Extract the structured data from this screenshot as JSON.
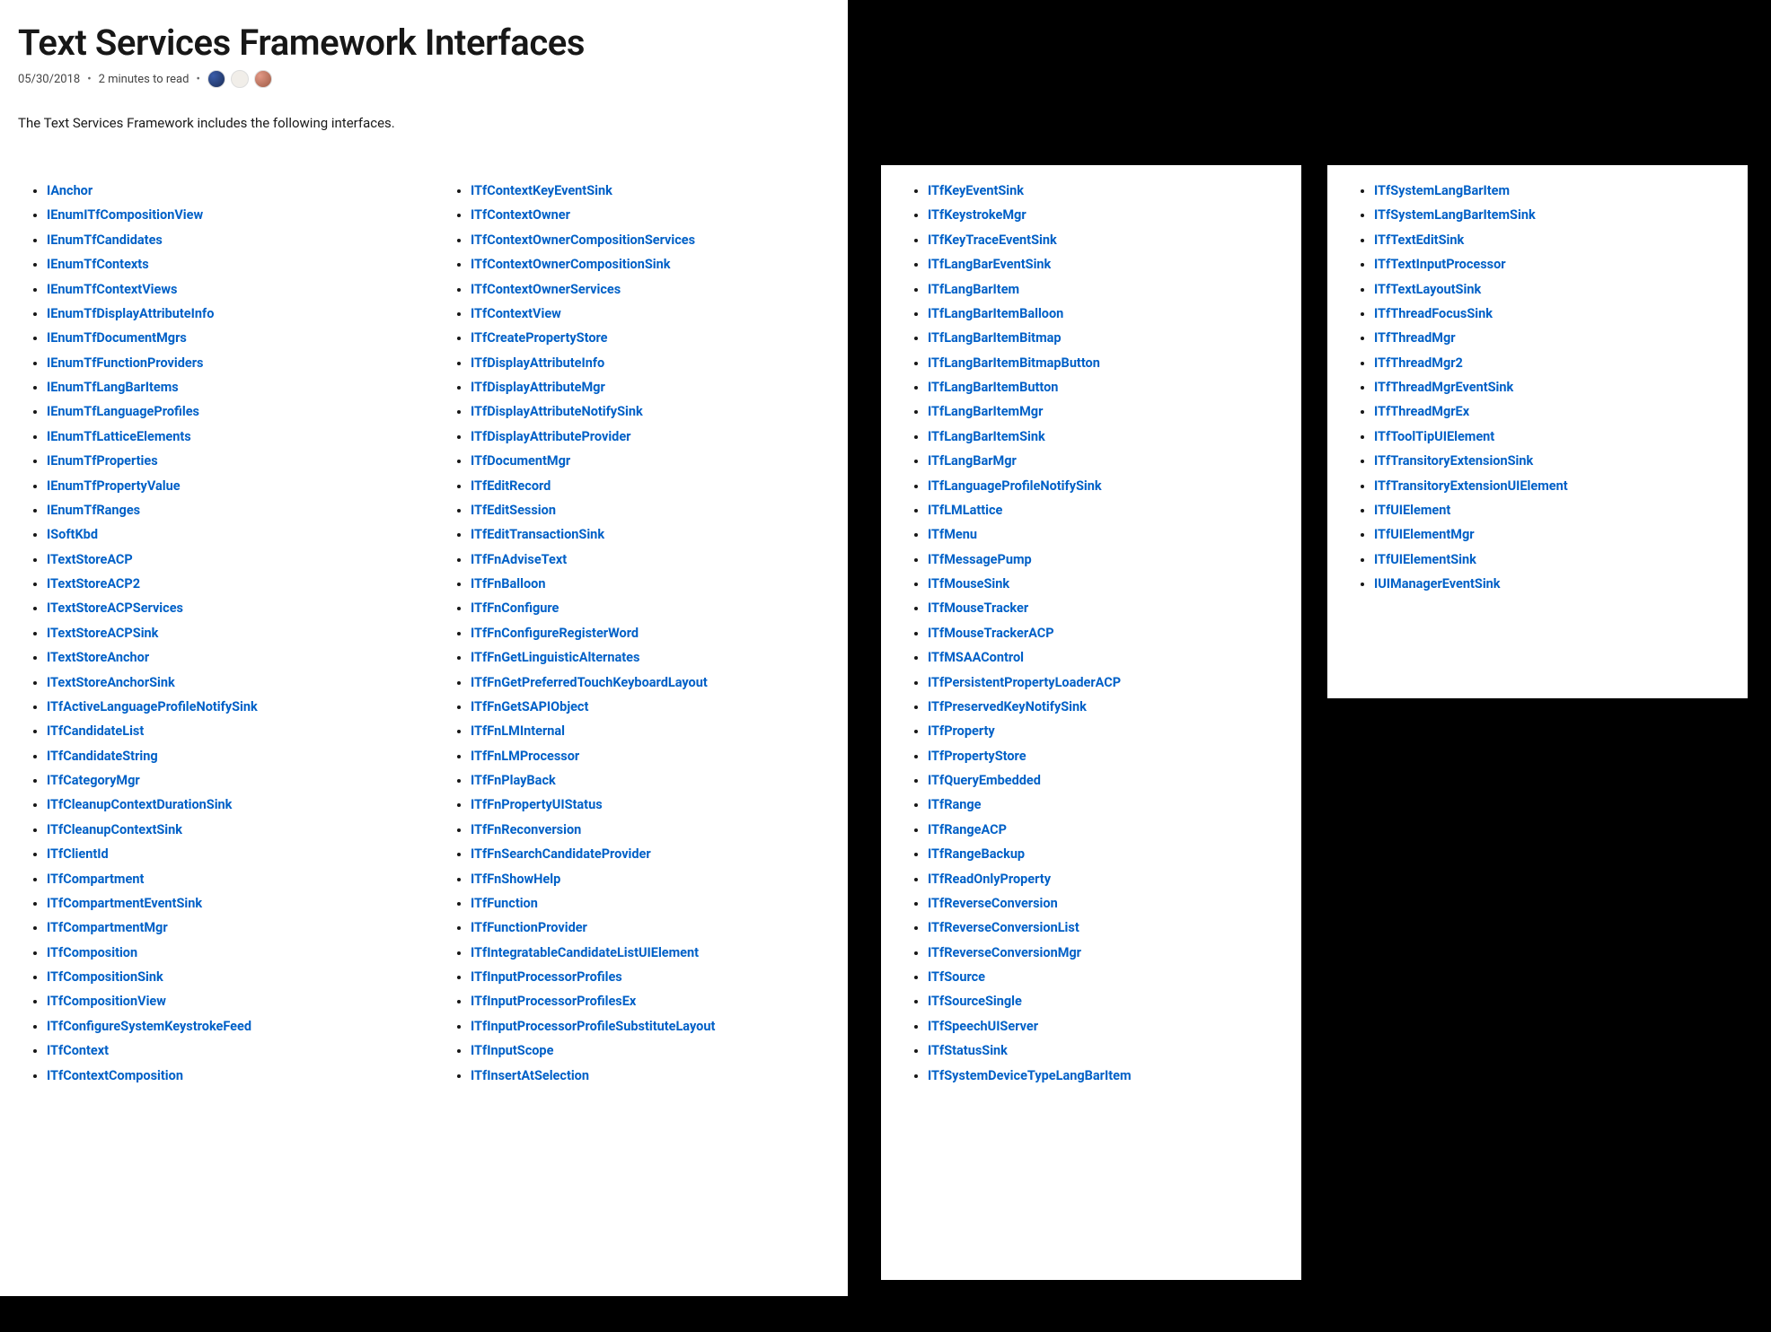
{
  "title": "Text Services Framework Interfaces",
  "date": "05/30/2018",
  "read_time": "2 minutes to read",
  "intro": "The Text Services Framework includes the following interfaces.",
  "columns": [
    [
      "IAnchor",
      "IEnumITfCompositionView",
      "IEnumTfCandidates",
      "IEnumTfContexts",
      "IEnumTfContextViews",
      "IEnumTfDisplayAttributeInfo",
      "IEnumTfDocumentMgrs",
      "IEnumTfFunctionProviders",
      "IEnumTfLangBarItems",
      "IEnumTfLanguageProfiles",
      "IEnumTfLatticeElements",
      "IEnumTfProperties",
      "IEnumTfPropertyValue",
      "IEnumTfRanges",
      "ISoftKbd",
      "ITextStoreACP",
      "ITextStoreACP2",
      "ITextStoreACPServices",
      "ITextStoreACPSink",
      "ITextStoreAnchor",
      "ITextStoreAnchorSink",
      "ITfActiveLanguageProfileNotifySink",
      "ITfCandidateList",
      "ITfCandidateString",
      "ITfCategoryMgr",
      "ITfCleanupContextDurationSink",
      "ITfCleanupContextSink",
      "ITfClientId",
      "ITfCompartment",
      "ITfCompartmentEventSink",
      "ITfCompartmentMgr",
      "ITfComposition",
      "ITfCompositionSink",
      "ITfCompositionView",
      "ITfConfigureSystemKeystrokeFeed",
      "ITfContext",
      "ITfContextComposition"
    ],
    [
      "ITfContextKeyEventSink",
      "ITfContextOwner",
      "ITfContextOwnerCompositionServices",
      "ITfContextOwnerCompositionSink",
      "ITfContextOwnerServices",
      "ITfContextView",
      "ITfCreatePropertyStore",
      "ITfDisplayAttributeInfo",
      "ITfDisplayAttributeMgr",
      "ITfDisplayAttributeNotifySink",
      "ITfDisplayAttributeProvider",
      "ITfDocumentMgr",
      "ITfEditRecord",
      "ITfEditSession",
      "ITfEditTransactionSink",
      "ITfFnAdviseText",
      "ITfFnBalloon",
      "ITfFnConfigure",
      "ITfFnConfigureRegisterWord",
      "ITfFnGetLinguisticAlternates",
      "ITfFnGetPreferredTouchKeyboardLayout",
      "ITfFnGetSAPIObject",
      "ITfFnLMInternal",
      "ITfFnLMProcessor",
      "ITfFnPlayBack",
      "ITfFnPropertyUIStatus",
      "ITfFnReconversion",
      "ITfFnSearchCandidateProvider",
      "ITfFnShowHelp",
      "ITfFunction",
      "ITfFunctionProvider",
      "ITfIntegratableCandidateListUIElement",
      "ITfInputProcessorProfiles",
      "ITfInputProcessorProfilesEx",
      "ITfInputProcessorProfileSubstituteLayout",
      "ITfInputScope",
      "ITfInsertAtSelection"
    ],
    [
      "ITfKeyEventSink",
      "ITfKeystrokeMgr",
      "ITfKeyTraceEventSink",
      "ITfLangBarEventSink",
      "ITfLangBarItem",
      "ITfLangBarItemBalloon",
      "ITfLangBarItemBitmap",
      "ITfLangBarItemBitmapButton",
      "ITfLangBarItemButton",
      "ITfLangBarItemMgr",
      "ITfLangBarItemSink",
      "ITfLangBarMgr",
      "ITfLanguageProfileNotifySink",
      "ITfLMLattice",
      "ITfMenu",
      "ITfMessagePump",
      "ITfMouseSink",
      "ITfMouseTracker",
      "ITfMouseTrackerACP",
      "ITfMSAAControl",
      "ITfPersistentPropertyLoaderACP",
      "ITfPreservedKeyNotifySink",
      "ITfProperty",
      "ITfPropertyStore",
      "ITfQueryEmbedded",
      "ITfRange",
      "ITfRangeACP",
      "ITfRangeBackup",
      "ITfReadOnlyProperty",
      "ITfReverseConversion",
      "ITfReverseConversionList",
      "ITfReverseConversionMgr",
      "ITfSource",
      "ITfSourceSingle",
      "ITfSpeechUIServer",
      "ITfStatusSink",
      "ITfSystemDeviceTypeLangBarItem"
    ],
    [
      "ITfSystemLangBarItem",
      "ITfSystemLangBarItemSink",
      "ITfTextEditSink",
      "ITfTextInputProcessor",
      "ITfTextLayoutSink",
      "ITfThreadFocusSink",
      "ITfThreadMgr",
      "ITfThreadMgr2",
      "ITfThreadMgrEventSink",
      "ITfThreadMgrEx",
      "ITfToolTipUIElement",
      "ITfTransitoryExtensionSink",
      "ITfTransitoryExtensionUIElement",
      "ITfUIElement",
      "ITfUIElementMgr",
      "ITfUIElementSink",
      "IUIManagerEventSink"
    ]
  ]
}
